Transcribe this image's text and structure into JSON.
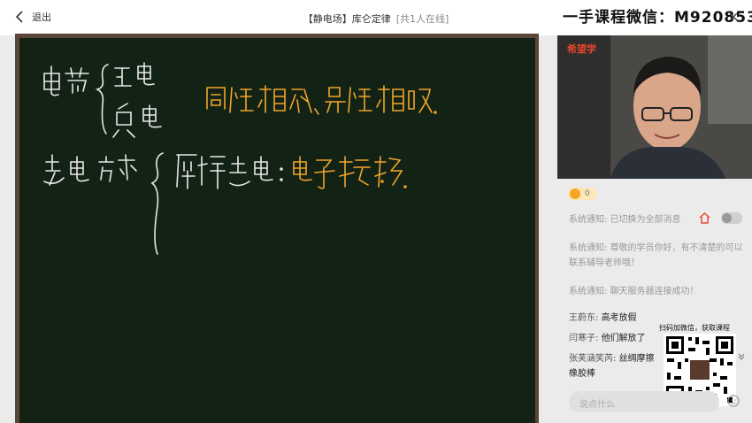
{
  "topbar": {
    "back_label": "退出",
    "title": "【静电场】库仑定律",
    "online": "[共1人在线]",
    "watermark": "一手课程微信：M920853"
  },
  "video": {
    "brand": "希望学"
  },
  "likes": {
    "count": "0"
  },
  "chat": {
    "messages": [
      {
        "sender": "系统通知: ",
        "text": "已切换为全部消息"
      },
      {
        "sender": "系统通知: ",
        "text": "尊敬的学员你好，有不清楚的可以联系辅导老师哦！"
      },
      {
        "sender": "系统通知: ",
        "text": "聊天服务器连接成功！"
      },
      {
        "sender": "王蔚东: ",
        "text": "高考放假"
      },
      {
        "sender": "闫寒子: ",
        "text": "他们解放了"
      },
      {
        "sender": "张芙涵笑芮: ",
        "text": "丝绸摩擦橡胶棒"
      }
    ],
    "input_placeholder": "说点什么"
  },
  "qr": {
    "caption": "扫码加微信，获取课程"
  },
  "colors": {
    "board": "#122316",
    "frame": "#5b4638",
    "ink_white": "#e8e8e8",
    "ink_orange": "#f2a52a",
    "brand": "#e8452c"
  }
}
